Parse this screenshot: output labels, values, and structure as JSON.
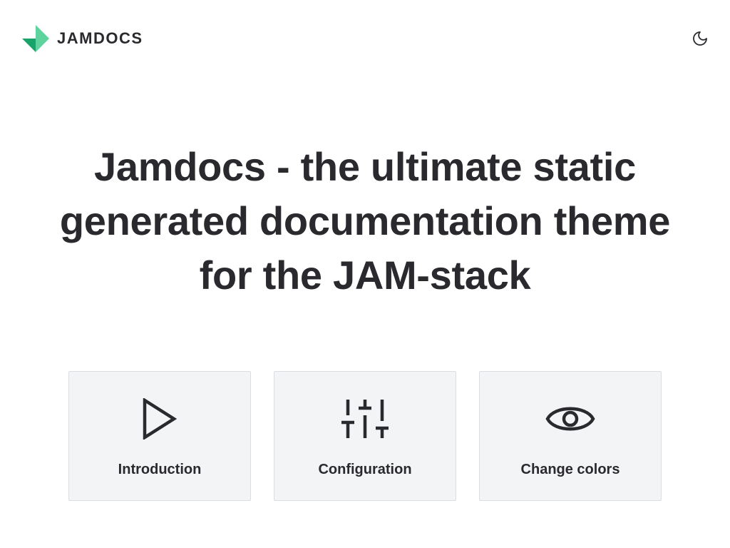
{
  "colors": {
    "text": "#29292e",
    "accent_light": "#5fd39d",
    "accent_dark": "#17a36a",
    "card_bg": "#f3f4f6",
    "card_border": "#dadde2"
  },
  "header": {
    "brand": {
      "name": "JAMDOCS",
      "logo_icon": "jamdocs-logo-icon"
    },
    "mode_toggle": {
      "icon": "moon-icon"
    }
  },
  "hero": {
    "title": "Jamdocs - the ultimate static generated documentation theme for the JAM-stack"
  },
  "cards": [
    {
      "label": "Introduction",
      "icon": "play-icon"
    },
    {
      "label": "Configuration",
      "icon": "sliders-icon"
    },
    {
      "label": "Change colors",
      "icon": "eye-icon"
    }
  ]
}
